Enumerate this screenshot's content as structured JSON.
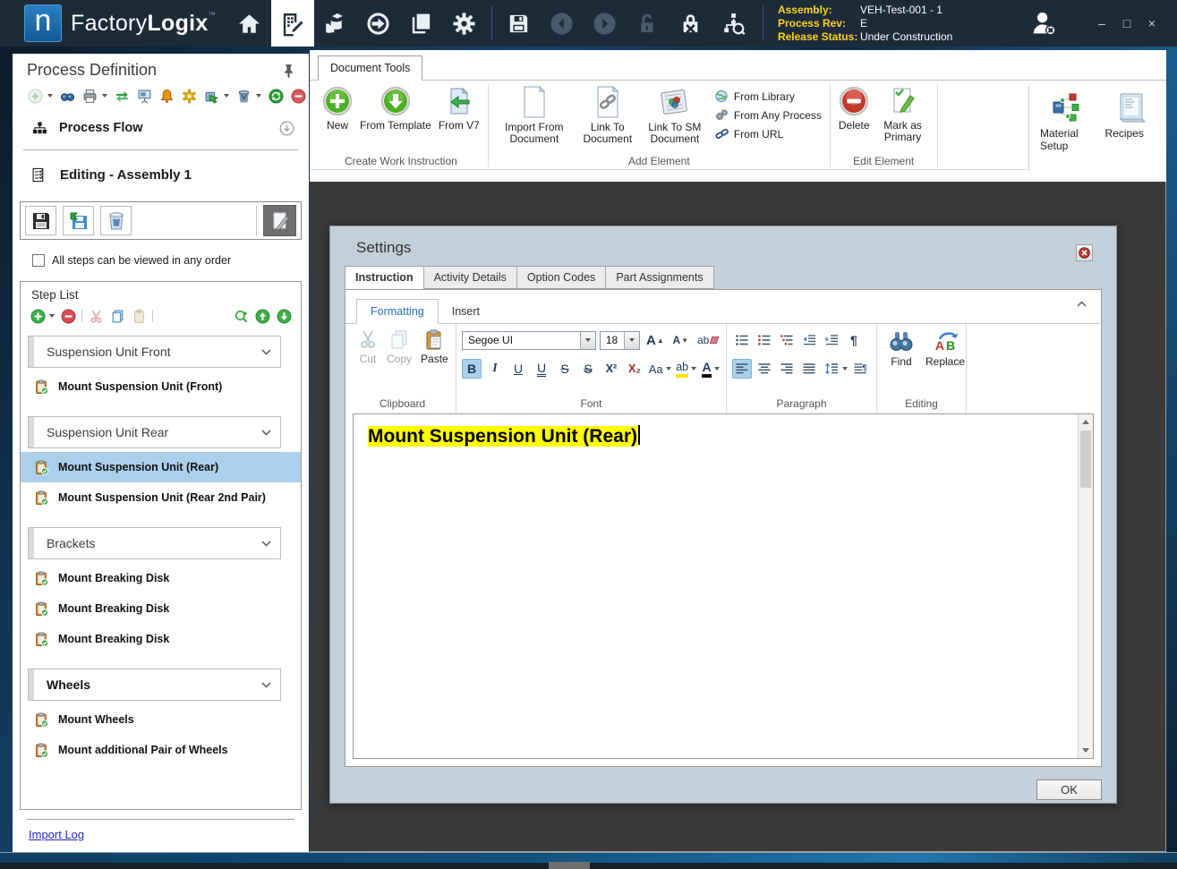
{
  "app": {
    "logo_letter": "n",
    "name_light": "Factory",
    "name_bold": "Logix",
    "tm": "™"
  },
  "titlebar": {
    "assembly_label": "Assembly:",
    "assembly_value": "VEH-Test-001 - 1",
    "process_rev_label": "Process Rev:",
    "process_rev_value": "E",
    "release_status_label": "Release Status:",
    "release_status_value": "Under Construction",
    "minimize": "–",
    "maximize": "□",
    "close": "×"
  },
  "left_panel": {
    "title": "Process Definition",
    "process_flow": "Process Flow",
    "editing": "Editing - Assembly 1",
    "order_checkbox": "All steps can be viewed in any order",
    "step_list_title": "Step List",
    "items": [
      {
        "type": "group",
        "label": "Suspension Unit Front"
      },
      {
        "type": "step",
        "label": "Mount Suspension Unit (Front)"
      },
      {
        "type": "group",
        "label": "Suspension Unit Rear"
      },
      {
        "type": "step",
        "label": "Mount Suspension Unit (Rear)",
        "selected": true
      },
      {
        "type": "step",
        "label": "Mount Suspension Unit (Rear 2nd Pair)"
      },
      {
        "type": "group",
        "label": "Brackets"
      },
      {
        "type": "step",
        "label": "Mount Breaking Disk"
      },
      {
        "type": "step",
        "label": "Mount Breaking Disk"
      },
      {
        "type": "step",
        "label": "Mount Breaking Disk"
      },
      {
        "type": "group",
        "label": "Wheels",
        "bold": true
      },
      {
        "type": "step",
        "label": "Mount Wheels"
      },
      {
        "type": "step",
        "label": "Mount additional Pair of Wheels"
      }
    ],
    "import_log": "Import Log"
  },
  "ribbon": {
    "tab": "Document Tools",
    "create_group": {
      "label": "Create Work Instruction",
      "new": "New",
      "from_template": "From Template",
      "from_v7": "From V7"
    },
    "add_group": {
      "label": "Add Element",
      "import_from_document": "Import From Document",
      "link_to_document": "Link To Document",
      "link_to_sm_document": "Link To SM Document",
      "from_library": "From Library",
      "from_any_process": "From Any Process",
      "from_url": "From URL"
    },
    "edit_group": {
      "label": "Edit Element",
      "delete": "Delete",
      "mark_as_primary": "Mark as Primary"
    },
    "side": {
      "material_setup": "Material Setup",
      "recipes": "Recipes"
    }
  },
  "dialog": {
    "title": "Settings",
    "tabs": [
      {
        "label": "Instruction"
      },
      {
        "label": "Activity Details"
      },
      {
        "label": "Option Codes"
      },
      {
        "label": "Part Assignments"
      }
    ],
    "fmt_tab": "Formatting",
    "insert_tab": "Insert",
    "clipboard": {
      "label": "Clipboard",
      "cut": "Cut",
      "copy": "Copy",
      "paste": "Paste"
    },
    "font": {
      "label": "Font",
      "family": "Segoe UI",
      "size": "18",
      "grow": "A",
      "shrink": "A",
      "clear": "ab",
      "bold": "B",
      "italic": "I",
      "underline": "U",
      "double_underline": "U",
      "strikethrough": "S",
      "double_strikethrough": "S",
      "superscript": "X²",
      "subscript": "X₂",
      "change_case": "Aa",
      "highlight": "ab",
      "font_color": "A"
    },
    "paragraph": {
      "label": "Paragraph",
      "pilcrow": "¶"
    },
    "editing": {
      "label": "Editing",
      "find": "Find",
      "replace": "Replace",
      "replace_a": "A",
      "replace_b": "B"
    },
    "editor_text": "Mount Suspension Unit (Rear)",
    "ok": "OK"
  },
  "colors": {
    "titlebar_bg": "#1d2b39",
    "accent_blue": "#1766ab",
    "label_yellow": "#ffd21e",
    "selected_step": "#abd0ec",
    "highlight_yellow": "#ffff00",
    "doc_area": "#3a3a3a",
    "dialog_bg": "#c3cfd9"
  }
}
